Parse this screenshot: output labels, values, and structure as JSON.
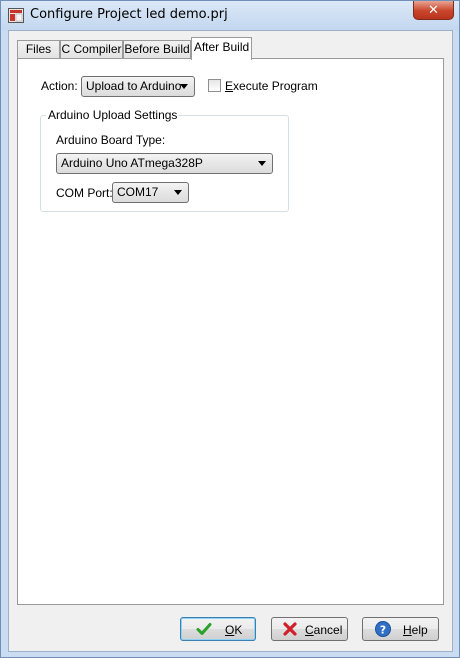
{
  "window": {
    "title": "Configure Project led demo.prj",
    "close_label": "✕"
  },
  "tabs": [
    {
      "label": "Files"
    },
    {
      "label": "C Compiler"
    },
    {
      "label": "Before Build"
    },
    {
      "label": "After Build"
    }
  ],
  "active_tab": "After Build",
  "action": {
    "label": "Action:",
    "value": "Upload to Arduino"
  },
  "execute_program": {
    "label_accel": "E",
    "label_rest": "xecute Program",
    "checked": false
  },
  "upload_settings": {
    "title": "Arduino Upload Settings",
    "board_label": "Arduino Board Type:",
    "board_value": "Arduino Uno ATmega328P",
    "com_label": "COM Port:",
    "com_value": "COM17"
  },
  "buttons": {
    "ok": {
      "accel": "O",
      "rest": "K",
      "icon": "check-icon"
    },
    "cancel": {
      "accel": "C",
      "rest": "ancel",
      "icon": "cross-icon"
    },
    "help": {
      "accel": "H",
      "rest": "elp",
      "icon": "help-icon"
    }
  },
  "colors": {
    "ok_icon": "#2aa12a",
    "cancel_icon": "#d0202a",
    "help_icon": "#2f6fc4"
  }
}
